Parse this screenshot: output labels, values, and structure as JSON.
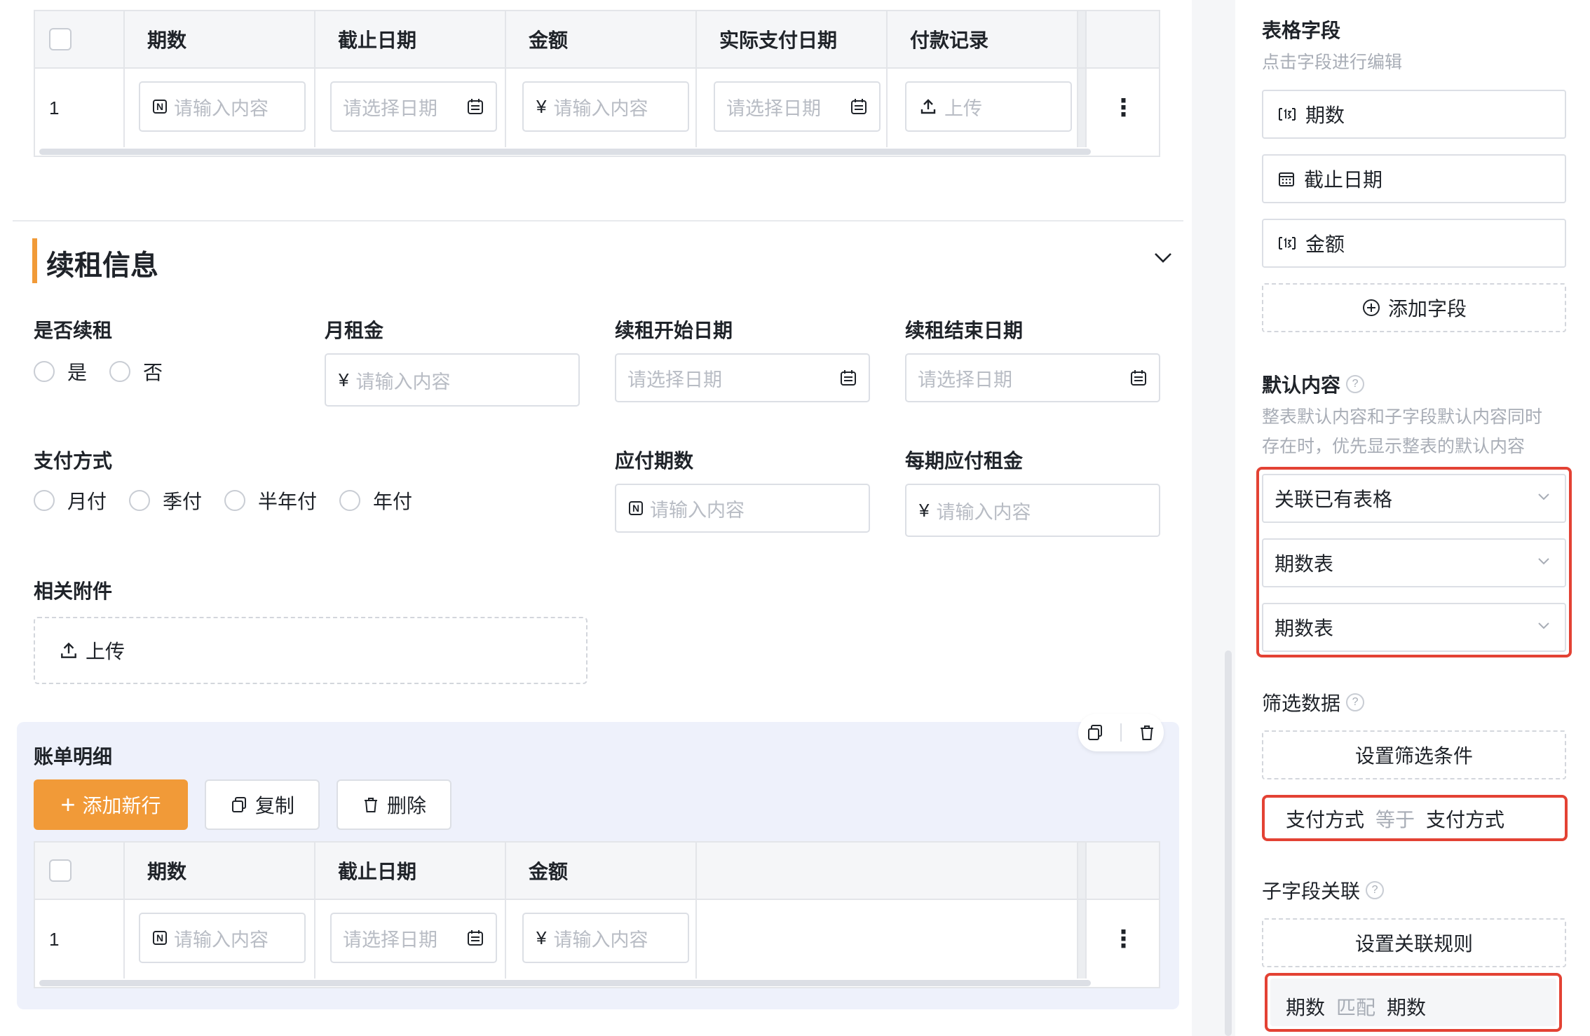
{
  "top_table": {
    "headers": [
      "期数",
      "截止日期",
      "金额",
      "实际支付日期",
      "付款记录"
    ],
    "row_number": "1",
    "placeholders": {
      "number": "请输入内容",
      "date": "请选择日期",
      "amount": "请输入内容",
      "actual_date": "请选择日期",
      "upload": "上传"
    },
    "currency_symbol": "¥"
  },
  "section": {
    "title": "续租信息",
    "renew": {
      "label": "是否续租",
      "options": [
        "是",
        "否"
      ]
    },
    "monthly_rent": {
      "label": "月租金",
      "placeholder": "请输入内容"
    },
    "renew_start": {
      "label": "续租开始日期",
      "placeholder": "请选择日期"
    },
    "renew_end": {
      "label": "续租结束日期",
      "placeholder": "请选择日期"
    },
    "payment_method": {
      "label": "支付方式",
      "options": [
        "月付",
        "季付",
        "半年付",
        "年付"
      ]
    },
    "periods_due": {
      "label": "应付期数",
      "placeholder": "请输入内容"
    },
    "rent_per_period": {
      "label": "每期应付租金",
      "placeholder": "请输入内容"
    },
    "attachments": {
      "label": "相关附件",
      "upload": "上传"
    }
  },
  "bill_detail": {
    "title": "账单明细",
    "add_row": "添加新行",
    "copy": "复制",
    "delete": "删除",
    "headers": [
      "期数",
      "截止日期",
      "金额"
    ],
    "row_number": "1",
    "placeholders": {
      "number": "请输入内容",
      "date": "请选择日期",
      "amount": "请输入内容"
    }
  },
  "panel": {
    "table_fields": {
      "title": "表格字段",
      "subtitle": "点击字段进行编辑",
      "fields": [
        "期数",
        "截止日期",
        "金额"
      ],
      "add_field": "添加字段"
    },
    "default_content": {
      "title": "默认内容",
      "desc_line1": "整表默认内容和子字段默认内容同时",
      "desc_line2": "存在时，优先显示整表的默认内容",
      "selects": [
        "关联已有表格",
        "期数表",
        "期数表"
      ]
    },
    "filter": {
      "title": "筛选数据",
      "button": "设置筛选条件",
      "rule": {
        "left": "支付方式",
        "op": "等于",
        "right": "支付方式"
      }
    },
    "subfield": {
      "title": "子字段关联",
      "button": "设置关联规则",
      "rule": {
        "left": "期数",
        "op": "匹配",
        "right": "期数"
      }
    }
  },
  "colors": {
    "accent": "#f19a38",
    "highlight": "#e34234",
    "border": "#dcdfe5"
  }
}
